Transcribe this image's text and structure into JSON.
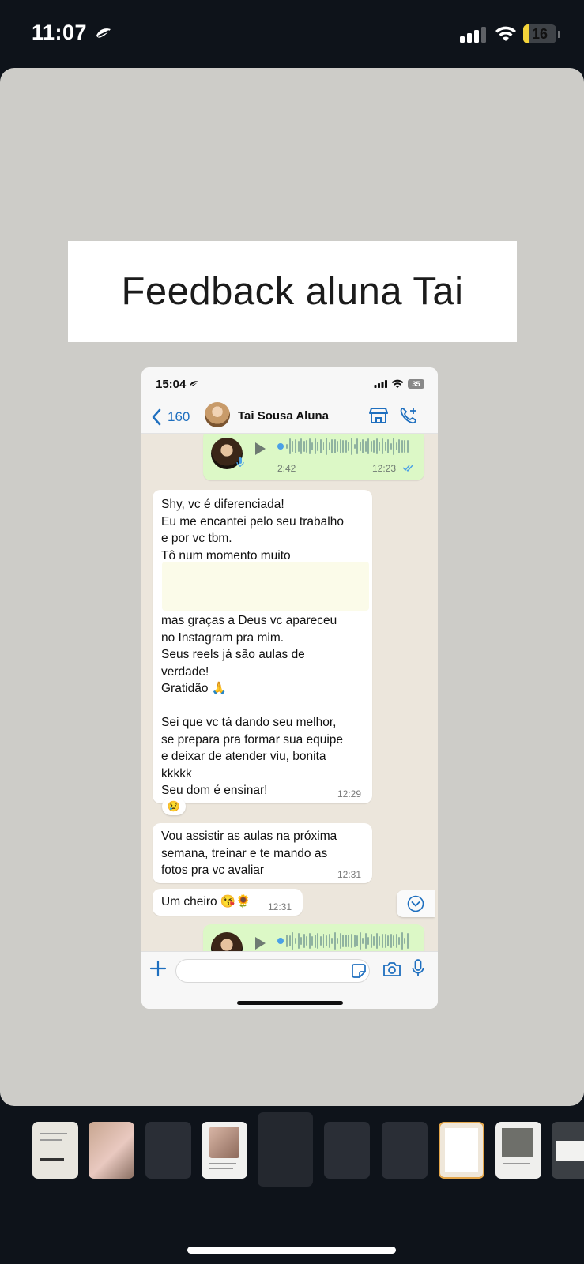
{
  "status_bar": {
    "time": "11:07",
    "battery": "16",
    "battery_level": 0.16,
    "battery_color": "#f4d43a"
  },
  "story": {
    "title": "Feedback aluna Tai"
  },
  "screenshot": {
    "status_time": "15:04",
    "status_battery": "35",
    "header": {
      "back_count": "160",
      "contact_name": "Tai Sousa Aluna"
    },
    "messages": [
      {
        "type": "voice",
        "direction": "outgoing",
        "duration": "2:42",
        "time": "12:23"
      },
      {
        "type": "text",
        "direction": "incoming",
        "text_top": "Shy, vc é diferenciada!\nEu me encantei pelo seu trabalho\ne por vc tbm.\nTô num momento muito",
        "text_bottom": "mas graças a Deus vc apareceu\nno Instagram pra mim.\nSeus reels já são aulas de\nverdade!\nGratidão 🙏\n\nSei que vc tá dando seu melhor,\nse prepara pra formar sua equipe\ne deixar de atender viu, bonita\nkkkkk\nSeu dom é ensinar!",
        "time": "12:29",
        "reaction": "😢"
      },
      {
        "type": "text",
        "direction": "incoming",
        "text": "Vou assistir as aulas na próxima\nsemana, treinar e te mando as\nfotos pra vc avaliar",
        "time": "12:31"
      },
      {
        "type": "text",
        "direction": "incoming",
        "text": "Um cheiro 😘🌻",
        "time": "12:31"
      },
      {
        "type": "voice",
        "direction": "outgoing"
      }
    ]
  },
  "colors": {
    "whatsapp_outgoing": "#dcf8c6",
    "whatsapp_incoming": "#ffffff",
    "ios_blue": "#1e6fbf",
    "story_background": "#cdccc8"
  }
}
